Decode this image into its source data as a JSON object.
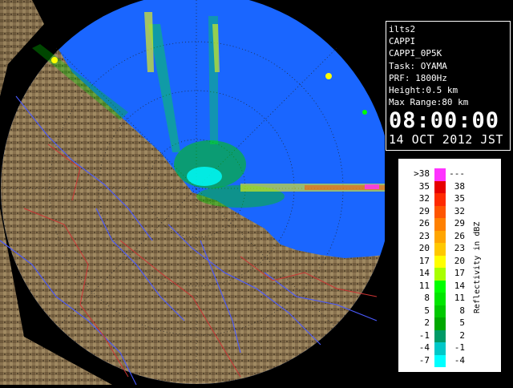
{
  "info": {
    "site": "ilts2",
    "product": "CAPPI",
    "product_id": "CAPPI_0P5K",
    "task": "Task: OYAMA",
    "prf": "PRF: 1800Hz",
    "height": "Height:0.5 km",
    "max_range": "Max Range:80 km",
    "time": "08:00:00",
    "date": "14 OCT 2012 JST"
  },
  "legend": {
    "title": "Reflectivity in dBZ",
    "bins": [
      {
        "low": ">38",
        "high": "---",
        "color": "#ff33ff"
      },
      {
        "low": "35",
        "high": "38",
        "color": "#e60000"
      },
      {
        "low": "32",
        "high": "35",
        "color": "#ff2a00"
      },
      {
        "low": "29",
        "high": "32",
        "color": "#ff5500"
      },
      {
        "low": "26",
        "high": "29",
        "color": "#ff8000"
      },
      {
        "low": "23",
        "high": "26",
        "color": "#ffa500"
      },
      {
        "low": "20",
        "high": "23",
        "color": "#ffc800"
      },
      {
        "low": "17",
        "high": "20",
        "color": "#ffff00"
      },
      {
        "low": "14",
        "high": "17",
        "color": "#a8ff00"
      },
      {
        "low": "11",
        "high": "14",
        "color": "#00ff00"
      },
      {
        "low": "8",
        "high": "11",
        "color": "#00e600"
      },
      {
        "low": "5",
        "high": "8",
        "color": "#00c800"
      },
      {
        "low": "2",
        "high": "5",
        "color": "#00a800"
      },
      {
        "low": "-1",
        "high": "2",
        "color": "#009a66"
      },
      {
        "low": "-4",
        "high": "-1",
        "color": "#00c8c8"
      },
      {
        "low": "-7",
        "high": "-4",
        "color": "#00ffff"
      }
    ]
  },
  "colors": {
    "sea": "#1a66ff",
    "land": "#8a7350",
    "rivers": "#4a5aff",
    "borders": "#cc3333",
    "background": "#000000"
  }
}
